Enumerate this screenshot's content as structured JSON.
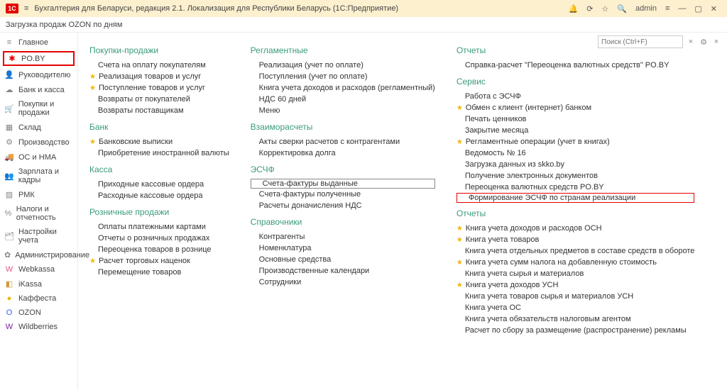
{
  "topbar": {
    "title": "Бухгалтерия для Беларуси, редакция 2.1. Локализация для Республики Беларусь",
    "product": "(1С:Предприятие)",
    "user": "admin"
  },
  "subbar": {
    "text": "Загрузка продаж OZON по дням"
  },
  "search": {
    "placeholder": "Поиск (Ctrl+F)"
  },
  "sidebar": [
    {
      "icon": "≡",
      "label": "Главное"
    },
    {
      "icon": "✱",
      "label": "PO.BY",
      "selected": true
    },
    {
      "icon": "👤",
      "label": "Руководителю"
    },
    {
      "icon": "☁",
      "label": "Банк и касса"
    },
    {
      "icon": "🛒",
      "label": "Покупки и продажи"
    },
    {
      "icon": "▦",
      "label": "Склад"
    },
    {
      "icon": "⚙",
      "label": "Производство"
    },
    {
      "icon": "🚚",
      "label": "ОС и НМА"
    },
    {
      "icon": "👥",
      "label": "Зарплата и кадры"
    },
    {
      "icon": "▧",
      "label": "РМК"
    },
    {
      "icon": "%",
      "label": "Налоги и отчетность"
    },
    {
      "icon": "🗂",
      "label": "Настройки учета"
    },
    {
      "icon": "✿",
      "label": "Администрирование"
    },
    {
      "icon": "W",
      "label": "Webkassa"
    },
    {
      "icon": "◧",
      "label": "iKassa"
    },
    {
      "icon": "●",
      "label": "Каффеста"
    },
    {
      "icon": "O",
      "label": "OZON"
    },
    {
      "icon": "W",
      "label": "Wildberries"
    }
  ],
  "sidebar_colors": [
    "#888",
    "#e60000",
    "#888",
    "#888",
    "#888",
    "#888",
    "#888",
    "#888",
    "#888",
    "#888",
    "#888",
    "#888",
    "#888",
    "#e05a8a",
    "#d49a3a",
    "#f4b400",
    "#2962ff",
    "#7b1fa2"
  ],
  "col1": {
    "sections": [
      {
        "h": "Покупки-продажи",
        "items": [
          {
            "t": "Счета на оплату покупателям",
            "star": false
          },
          {
            "t": "Реализация товаров и услуг",
            "star": true
          },
          {
            "t": "Поступление товаров и услуг",
            "star": true
          },
          {
            "t": "Возвраты от покупателей",
            "star": false
          },
          {
            "t": "Возвраты поставщикам",
            "star": false
          }
        ]
      },
      {
        "h": "Банк",
        "items": [
          {
            "t": "Банковские выписки",
            "star": true
          },
          {
            "t": "Приобретение иностранной валюты",
            "star": false
          }
        ]
      },
      {
        "h": "Касса",
        "items": [
          {
            "t": "Приходные кассовые ордера",
            "star": false
          },
          {
            "t": "Расходные кассовые ордера",
            "star": false
          }
        ]
      },
      {
        "h": "Розничные продажи",
        "items": [
          {
            "t": "Оплаты платежными картами",
            "star": false
          },
          {
            "t": "Отчеты о розничных продажах",
            "star": false
          },
          {
            "t": "Переоценка товаров в рознице",
            "star": false
          },
          {
            "t": "Расчет торговых наценок",
            "star": true
          },
          {
            "t": "Перемещение товаров",
            "star": false
          }
        ]
      }
    ]
  },
  "col2": {
    "sections": [
      {
        "h": "Регламентные",
        "items": [
          {
            "t": "Реализация (учет по оплате)",
            "star": false
          },
          {
            "t": "Поступления (учет по оплате)",
            "star": false
          },
          {
            "t": "Книга учета доходов и расходов (регламентный)",
            "star": false
          },
          {
            "t": "НДС 60 дней",
            "star": false
          },
          {
            "t": "Меню",
            "star": false
          }
        ]
      },
      {
        "h": "Взаиморасчеты",
        "items": [
          {
            "t": "Акты сверки расчетов с контрагентами",
            "star": false
          },
          {
            "t": "Корректировка долга",
            "star": false
          }
        ]
      },
      {
        "h": "ЭСЧФ",
        "items": [
          {
            "t": "Счета-фактуры выданные",
            "star": false,
            "boxed": true
          },
          {
            "t": "Счета-фактуры полученные",
            "star": false
          },
          {
            "t": "Расчеты доначисления НДС",
            "star": false
          }
        ]
      },
      {
        "h": "Справочники",
        "items": [
          {
            "t": "Контрагенты",
            "star": false
          },
          {
            "t": "Номенклатура",
            "star": false
          },
          {
            "t": "Основные средства",
            "star": false
          },
          {
            "t": "Производственные календари",
            "star": false
          },
          {
            "t": "Сотрудники",
            "star": false
          }
        ]
      }
    ]
  },
  "col3": {
    "sections": [
      {
        "h": "Отчеты",
        "items": [
          {
            "t": "Справка-расчет \"Переоценка валютных средств\" PO.BY",
            "star": false
          }
        ]
      },
      {
        "h": "Сервис",
        "items": [
          {
            "t": "Работа с ЭСЧФ",
            "star": false
          },
          {
            "t": "Обмен с клиент (интернет) банком",
            "star": true
          },
          {
            "t": "Печать ценников",
            "star": false
          },
          {
            "t": "Закрытие месяца",
            "star": false
          },
          {
            "t": "Регламентные операции (учет в книгах)",
            "star": true
          },
          {
            "t": "Ведомость № 16",
            "star": false
          },
          {
            "t": "Загрузка данных из skko.by",
            "star": false
          },
          {
            "t": "Получение электронных документов",
            "star": false
          },
          {
            "t": "Переоценка валютных средств PO.BY",
            "star": false
          },
          {
            "t": "Формирование ЭСЧФ по странам реализации",
            "star": false,
            "redbox": true
          }
        ]
      },
      {
        "h": "Отчеты",
        "items": [
          {
            "t": "Книга учета доходов и расходов ОСН",
            "star": true
          },
          {
            "t": "Книга учета товаров",
            "star": true
          },
          {
            "t": "Книга учета отдельных предметов в составе средств в обороте",
            "star": false
          },
          {
            "t": "Книга учета сумм налога на добавленную стоимость",
            "star": true
          },
          {
            "t": "Книга учета сырья и материалов",
            "star": false
          },
          {
            "t": "Книга учета доходов УСН",
            "star": true
          },
          {
            "t": "Книга учета товаров сырья и материалов УСН",
            "star": false
          },
          {
            "t": "Книга учета ОС",
            "star": false
          },
          {
            "t": "Книга учета обязательств налоговым агентом",
            "star": false
          },
          {
            "t": "Расчет по сбору за размещение (распространение) рекламы",
            "star": false
          }
        ]
      }
    ]
  }
}
